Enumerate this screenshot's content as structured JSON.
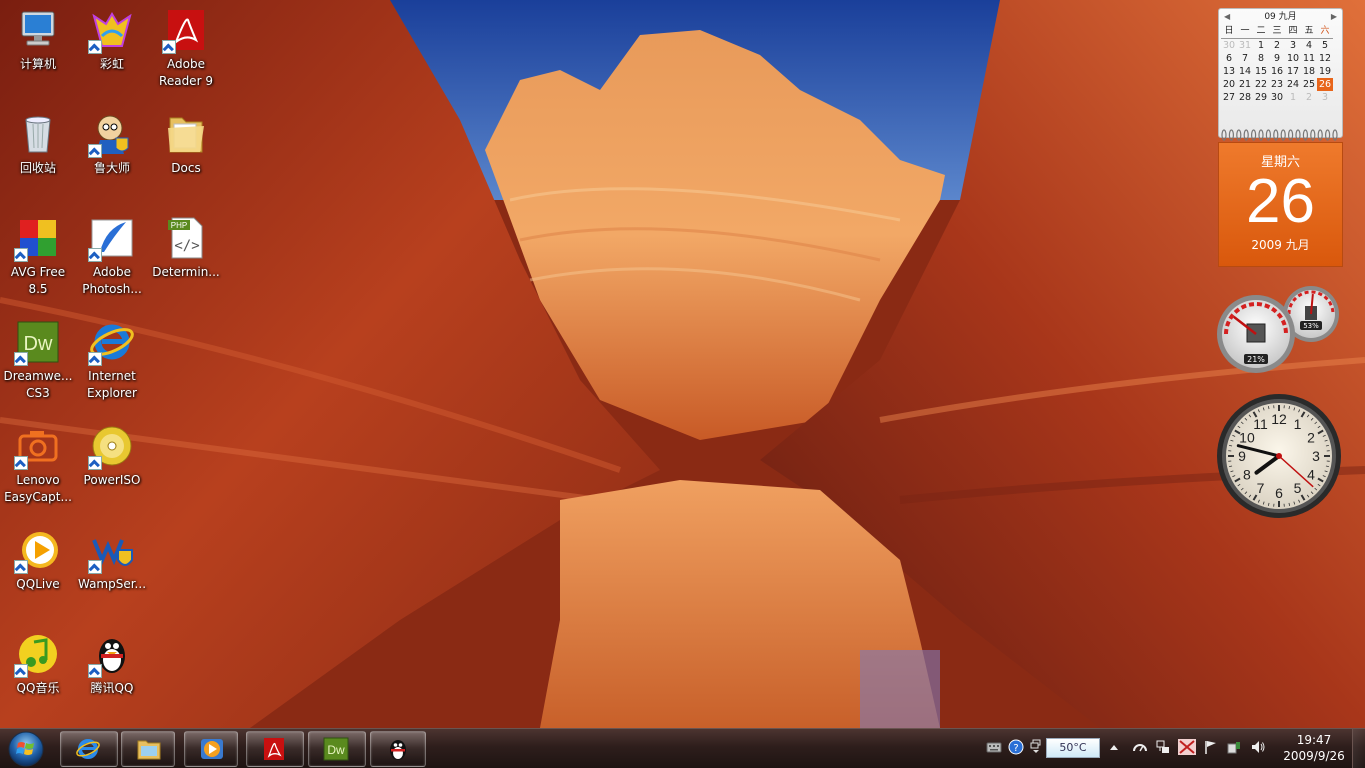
{
  "desktop": {
    "icons": [
      {
        "label": "计算机",
        "icon": "computer-icon",
        "shortcut": false
      },
      {
        "label": "回收站",
        "icon": "recycle-bin-icon",
        "shortcut": false
      },
      {
        "label": "AVG Free\n8.5",
        "icon": "avg-icon",
        "shortcut": true
      },
      {
        "label": "Dreamwe...\nCS3",
        "icon": "dreamweaver-icon",
        "shortcut": true
      },
      {
        "label": "Lenovo\nEasyCapt...",
        "icon": "camera-icon",
        "shortcut": true
      },
      {
        "label": "QQLive",
        "icon": "qqlive-icon",
        "shortcut": true
      },
      {
        "label": "QQ音乐",
        "icon": "qqmusic-icon",
        "shortcut": true
      },
      {
        "label": "彩虹",
        "icon": "rainbow-icon",
        "shortcut": true
      },
      {
        "label": "鲁大师",
        "icon": "ludashi-icon",
        "shortcut": true
      },
      {
        "label": "Adobe\nPhotosh...",
        "icon": "photoshop-icon",
        "shortcut": true
      },
      {
        "label": "Internet\nExplorer",
        "icon": "ie-icon",
        "shortcut": true
      },
      {
        "label": "PowerISO",
        "icon": "poweriso-icon",
        "shortcut": true
      },
      {
        "label": "WampSer...",
        "icon": "wampserver-icon",
        "shortcut": true
      },
      {
        "label": "腾讯QQ",
        "icon": "qq-penguin-icon",
        "shortcut": true
      },
      {
        "label": "Adobe\nReader 9",
        "icon": "adobe-reader-icon",
        "shortcut": true
      },
      {
        "label": "Docs",
        "icon": "folder-icon",
        "shortcut": false
      },
      {
        "label": "Determin...",
        "icon": "php-file-icon",
        "shortcut": false
      }
    ]
  },
  "calendar_gadget": {
    "month_header": "09 九月",
    "weekdays": [
      "日",
      "一",
      "二",
      "三",
      "四",
      "五",
      "六"
    ],
    "weeks": [
      [
        "30",
        "31",
        "1",
        "2",
        "3",
        "4",
        "5"
      ],
      [
        "6",
        "7",
        "8",
        "9",
        "10",
        "11",
        "12"
      ],
      [
        "13",
        "14",
        "15",
        "16",
        "17",
        "18",
        "19"
      ],
      [
        "20",
        "21",
        "22",
        "23",
        "24",
        "25",
        "26"
      ],
      [
        "27",
        "28",
        "29",
        "30",
        "1",
        "2",
        "3"
      ]
    ],
    "today": "26",
    "day_of_week": "星期六",
    "big_day": "26",
    "year_month": "2009 九月"
  },
  "cpu_meter": {
    "cpu_percent_label": "21%",
    "memory_percent_label": "53%",
    "cpu_percent": 21,
    "memory_percent": 53
  },
  "clock_gadget": {
    "hour": 7,
    "minute": 47,
    "second": 22
  },
  "taskbar": {
    "pinned": [
      {
        "name": "ie-icon"
      },
      {
        "name": "explorer-folder-icon"
      },
      {
        "name": "media-player-icon"
      },
      {
        "name": "adobe-reader-icon"
      },
      {
        "name": "dreamweaver-icon"
      },
      {
        "name": "qq-penguin-icon"
      }
    ],
    "tray": {
      "temperature": "50°C",
      "time": "19:47",
      "date": "2009/9/26"
    }
  },
  "colors": {
    "taskbar": "#2e1e1c",
    "calendar_accent": "#e8651a",
    "icon_label": "#ffffff"
  }
}
